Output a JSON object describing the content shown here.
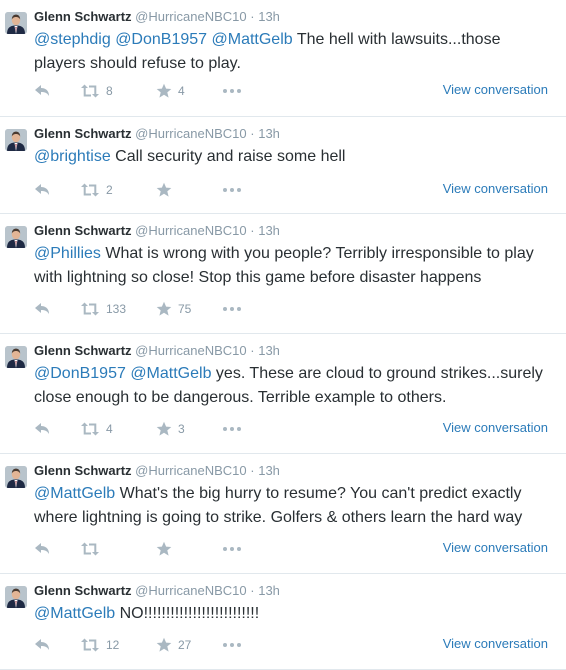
{
  "tweets": [
    {
      "name": "Glenn Schwartz",
      "handle": "@HurricaneNBC10",
      "dot": "·",
      "time": "13h",
      "lines": [
        [
          {
            "t": "@stephdig",
            "m": true
          },
          {
            "t": " ",
            "m": false
          },
          {
            "t": "@DonB1957",
            "m": true
          },
          {
            "t": " ",
            "m": false
          },
          {
            "t": "@MattGelb",
            "m": true
          },
          {
            "t": " The hell with lawsuits...those",
            "m": false
          }
        ],
        [
          {
            "t": "players should refuse to play.",
            "m": false
          }
        ]
      ],
      "retweets": "8",
      "favorites": "4",
      "view": "View conversation"
    },
    {
      "name": "Glenn Schwartz",
      "handle": "@HurricaneNBC10",
      "dot": "·",
      "time": "13h",
      "lines": [
        [
          {
            "t": "@brightise",
            "m": true
          },
          {
            "t": " Call security and raise some hell",
            "m": false
          }
        ]
      ],
      "retweets": "2",
      "favorites": "",
      "view": "View conversation"
    },
    {
      "name": "Glenn Schwartz",
      "handle": "@HurricaneNBC10",
      "dot": "·",
      "time": "13h",
      "lines": [
        [
          {
            "t": "@Phillies",
            "m": true
          },
          {
            "t": " What is wrong with you people? Terribly irresponsible to play",
            "m": false
          }
        ],
        [
          {
            "t": "with lightning so close! Stop this game before disaster happens",
            "m": false
          }
        ]
      ],
      "retweets": "133",
      "favorites": "75",
      "view": ""
    },
    {
      "name": "Glenn Schwartz",
      "handle": "@HurricaneNBC10",
      "dot": "·",
      "time": "13h",
      "lines": [
        [
          {
            "t": "@DonB1957",
            "m": true
          },
          {
            "t": " ",
            "m": false
          },
          {
            "t": "@MattGelb",
            "m": true
          },
          {
            "t": " yes. These are cloud to ground strikes...surely",
            "m": false
          }
        ],
        [
          {
            "t": "close enough to be dangerous. Terrible example to others.",
            "m": false
          }
        ]
      ],
      "retweets": "4",
      "favorites": "3",
      "view": "View conversation"
    },
    {
      "name": "Glenn Schwartz",
      "handle": "@HurricaneNBC10",
      "dot": "·",
      "time": "13h",
      "lines": [
        [
          {
            "t": "@MattGelb",
            "m": true
          },
          {
            "t": " What's the big hurry to resume? You can't predict exactly",
            "m": false
          }
        ],
        [
          {
            "t": "where lightning is going to strike. Golfers & others learn the hard way",
            "m": false
          }
        ]
      ],
      "retweets": "",
      "favorites": "",
      "view": "View conversation"
    },
    {
      "name": "Glenn Schwartz",
      "handle": "@HurricaneNBC10",
      "dot": "·",
      "time": "13h",
      "lines": [
        [
          {
            "t": "@MattGelb",
            "m": true
          },
          {
            "t": " NO!!!!!!!!!!!!!!!!!!!!!!!!!!",
            "m": false
          }
        ]
      ],
      "retweets": "12",
      "favorites": "27",
      "view": "View conversation"
    }
  ],
  "colors": {
    "mention": "#2b7bb9",
    "meta": "#8899a6",
    "icon": "#aab8c2",
    "text": "#292f33"
  },
  "icons": {
    "reply": "reply-icon",
    "retweet": "retweet-icon",
    "favorite": "star-icon",
    "more": "more-icon",
    "avatar": "avatar"
  }
}
